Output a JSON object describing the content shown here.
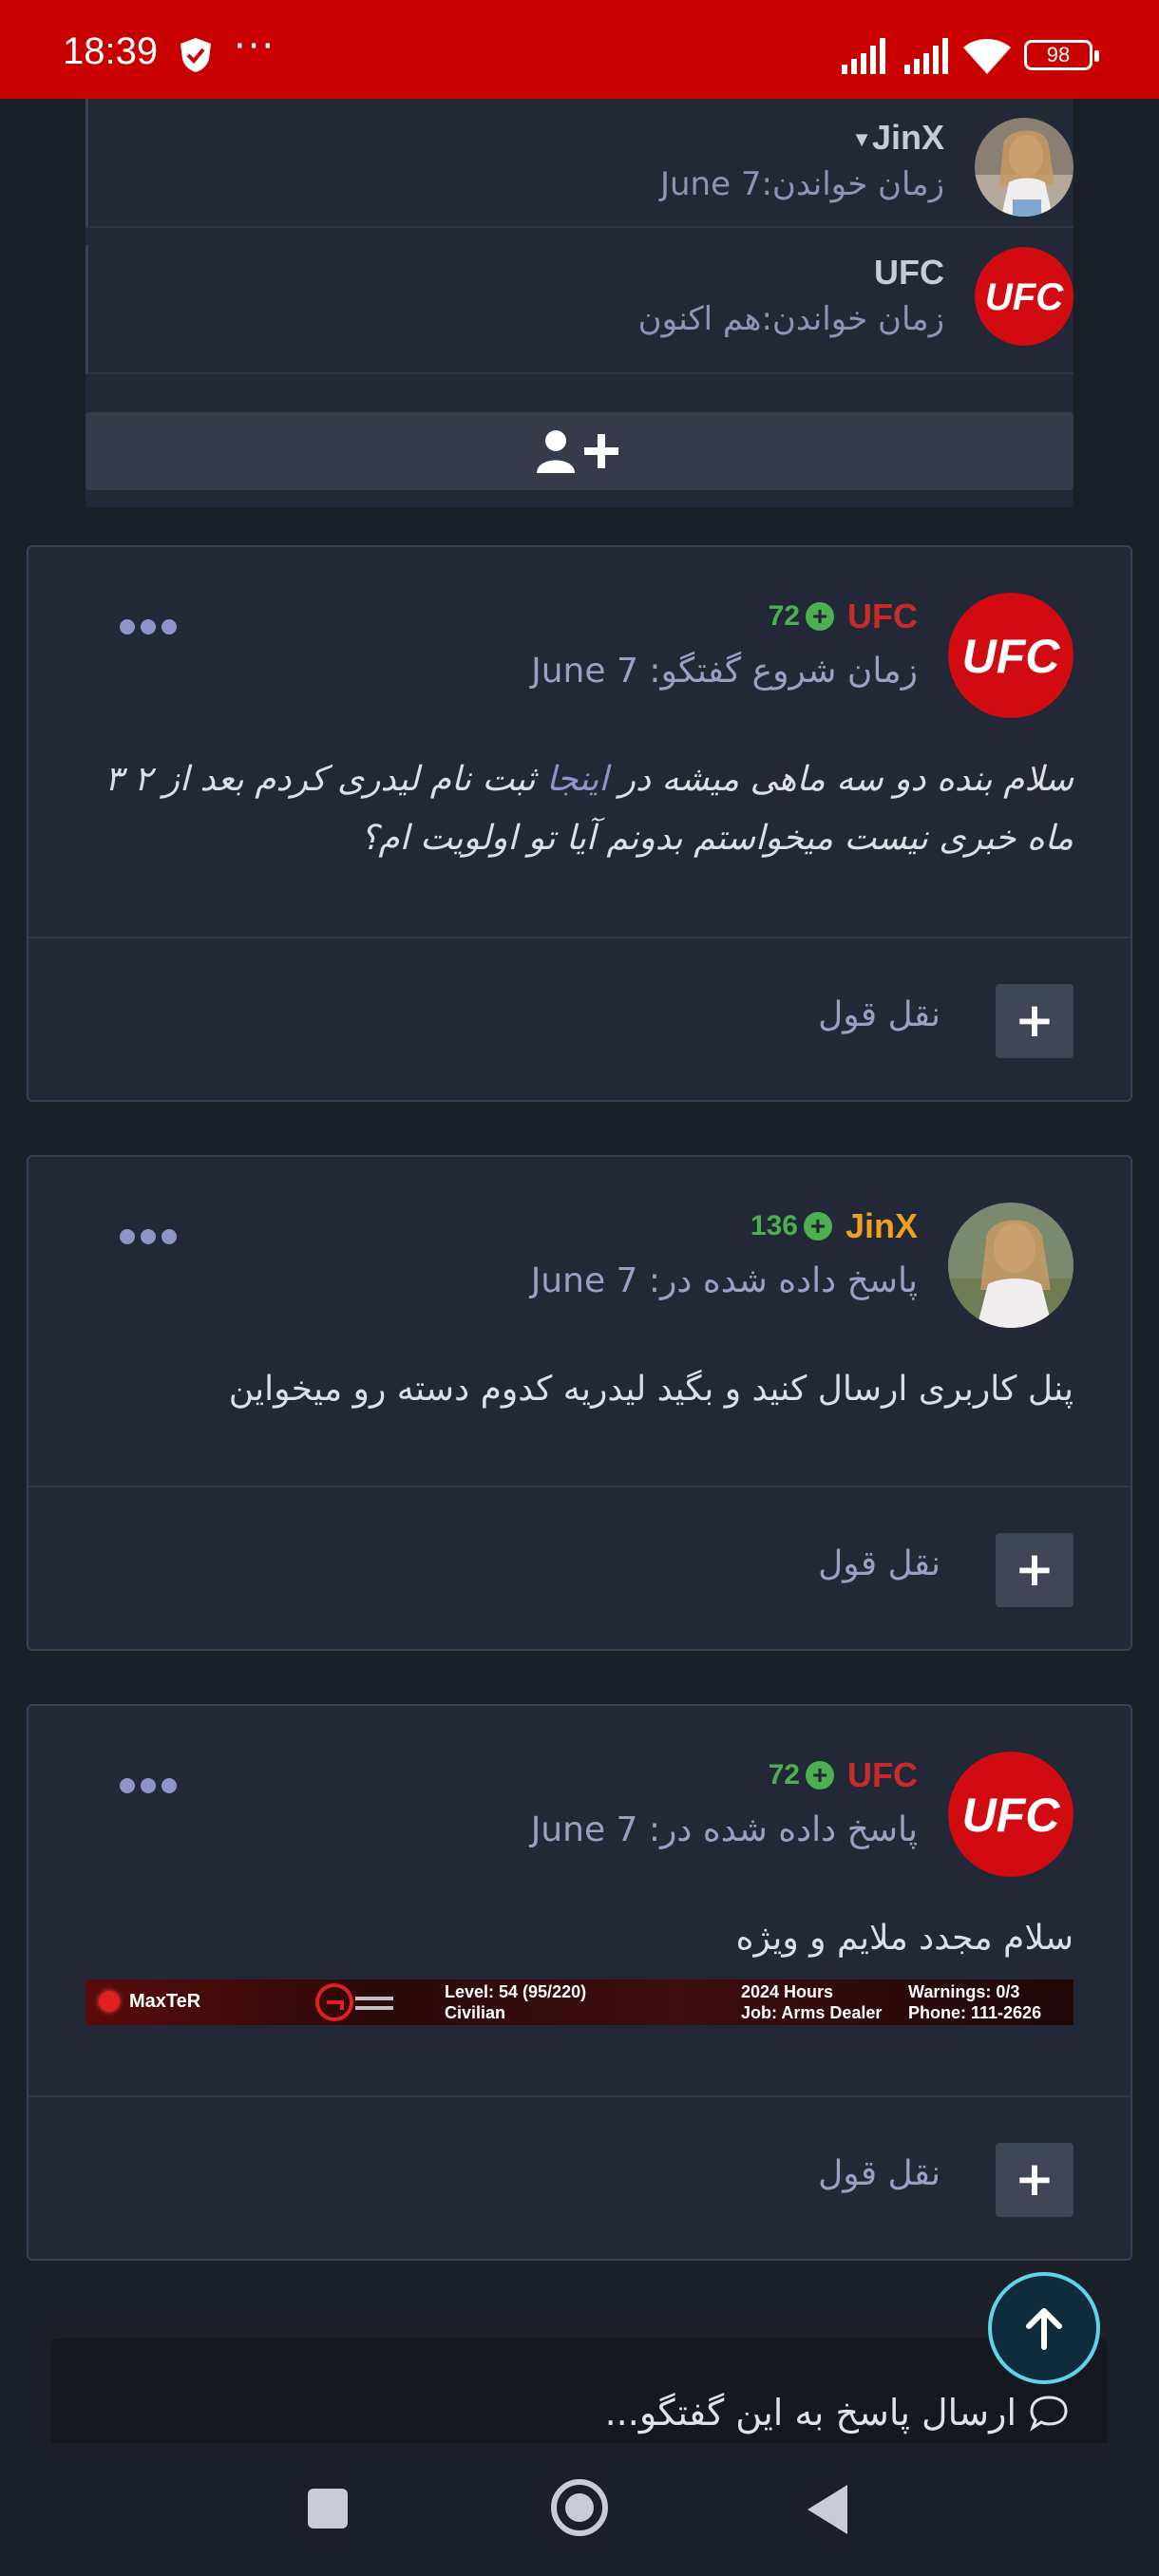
{
  "status_bar": {
    "time": "18:39",
    "battery": "98",
    "icons": [
      "shield-check-icon",
      "more-dots-icon",
      "signal-icon",
      "signal-icon",
      "wifi-icon",
      "battery-icon"
    ]
  },
  "readers": [
    {
      "name": "JinX",
      "read_time": "زمان خواندن:June 7",
      "avatar": "girl-photo"
    },
    {
      "name": "UFC",
      "read_time": "زمان خواندن:هم اکنون",
      "avatar": "ufc-logo"
    }
  ],
  "posts": [
    {
      "author": "UFC",
      "author_color": "#cc2a2a",
      "rep": "72",
      "date": "زمان شروع گفتگو: June 7",
      "body_before_link": "سلام بنده دو سه ماهی میشه در ",
      "body_link": "اینجا",
      "body_after_link": " ثبت نام لیدری کردم بعد از ۲ ۳ ماه خبری نیست میخواستم بدونم آیا تو اولویت ام؟",
      "quote_label": "نقل قول"
    },
    {
      "author": "JinX",
      "author_color": "#f0a020",
      "rep": "136",
      "date": "پاسخ داده شده در: June 7",
      "body": "پنل کاربری ارسال کنید و بگید لیدریه کدوم دسته رو میخواین",
      "quote_label": "نقل قول"
    },
    {
      "author": "UFC",
      "author_color": "#cc2a2a",
      "rep": "72",
      "date": "پاسخ داده شده در: June 7",
      "body": "سلام مجدد ملایم و ویژه",
      "quote_label": "نقل قول",
      "signature": {
        "name": "MaxTeR",
        "level": "Level: 54 (95/220)",
        "rank": "Civilian",
        "hours": "2024 Hours",
        "job": "Job: Arms Dealer",
        "warnings": "Warnings: 0/3",
        "phone": "Phone: 111-2626"
      }
    }
  ],
  "reply": {
    "label": "ارسال پاسخ به این گفتگو..."
  },
  "colors": {
    "status_bar": "#c80000",
    "background": "#1b1f28",
    "card": "#222835",
    "rep_green": "#4caf50",
    "accent_cyan": "#5fd3ea"
  }
}
